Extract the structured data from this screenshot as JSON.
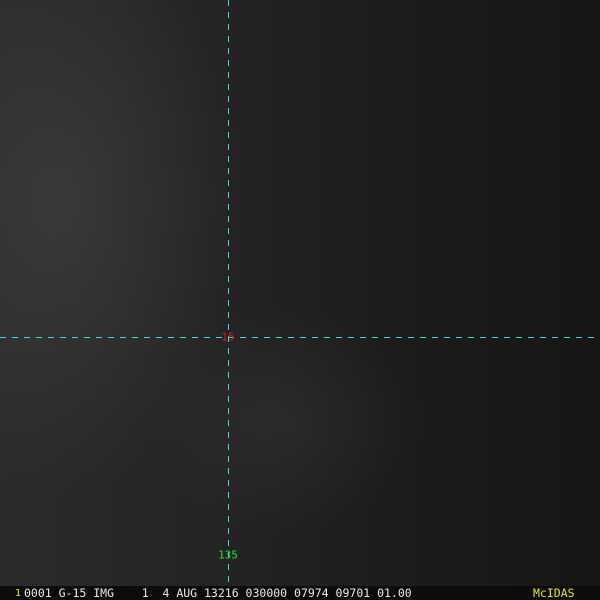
{
  "image": {
    "description_type": "satellite-ir-image"
  },
  "overlay": {
    "line_color": "#3fd6e6",
    "latitude_label": "15",
    "latitude_label_color": "#e01818",
    "longitude_label": "135",
    "longitude_label_color": "#22e022"
  },
  "status_bar": {
    "frame_number": "1",
    "info": "0001 G-15 IMG    1  4 AUG 13216 030000 07974 09701 01.00",
    "brand": "McIDAS",
    "brand_color": "#f0e020"
  }
}
